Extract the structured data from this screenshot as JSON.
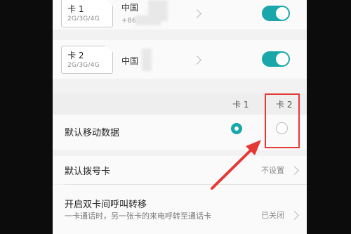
{
  "sim_cards": [
    {
      "name": "卡 1",
      "networks": "2G/3G/4G",
      "carrier": "中国",
      "number_prefix": "+86",
      "enabled": true
    },
    {
      "name": "卡 2",
      "networks": "2G/3G/4G",
      "carrier": "中国",
      "enabled": true
    }
  ],
  "columns": {
    "card1": "卡 1",
    "card2": "卡 2"
  },
  "default_data": {
    "label": "默认移动数据",
    "selected": "卡 1"
  },
  "default_dial": {
    "label": "默认拨号卡",
    "value": "不设置"
  },
  "call_forward": {
    "label": "开启双卡间呼叫转移",
    "description": "一卡通话时，另一张卡的来电呼转至通话卡",
    "value": "已关闭"
  },
  "colors": {
    "accent": "#19a7a9",
    "highlight": "#e53935"
  }
}
